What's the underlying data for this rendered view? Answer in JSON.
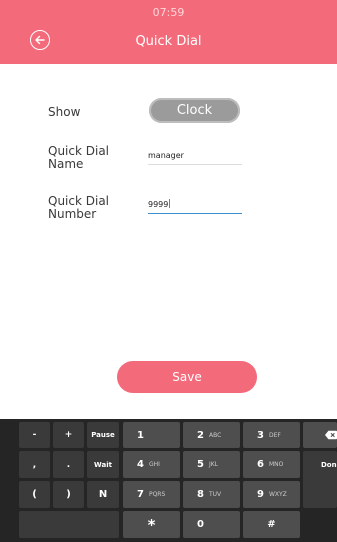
{
  "status_bar": {
    "time": "07:59"
  },
  "header": {
    "title": "Quick Dial",
    "back_icon": "back-circle-arrow-icon"
  },
  "form": {
    "show_label": "Show",
    "show_value": "Clock",
    "name_label_line1": "Quick Dial",
    "name_label_line2": "Name",
    "name_value": "manager",
    "number_label_line1": "Quick Dial",
    "number_label_line2": "Number",
    "number_value": "9999"
  },
  "actions": {
    "save_label": "Save"
  },
  "keyboard": {
    "symbol_keys": [
      "-",
      "+",
      "Pause",
      ",",
      ".",
      "Wait",
      "(",
      ")",
      "N"
    ],
    "digit_keys": [
      {
        "digit": "1",
        "letters": ""
      },
      {
        "digit": "2",
        "letters": "ABC"
      },
      {
        "digit": "3",
        "letters": "DEF"
      },
      {
        "digit": "4",
        "letters": "GHI"
      },
      {
        "digit": "5",
        "letters": "JKL"
      },
      {
        "digit": "6",
        "letters": "MNO"
      },
      {
        "digit": "7",
        "letters": "PQRS"
      },
      {
        "digit": "8",
        "letters": "TUV"
      },
      {
        "digit": "9",
        "letters": "WXYZ"
      },
      {
        "digit": "*",
        "letters": ""
      },
      {
        "digit": "0",
        "letters": ""
      },
      {
        "digit": "#",
        "letters": ""
      }
    ],
    "backspace_icon": "backspace-icon",
    "done_label": "Done"
  },
  "colors": {
    "accent": "#f36b7b",
    "toggle": "#9b9b9b",
    "focus": "#3b8ed0",
    "keyboard_bg": "#252525"
  }
}
